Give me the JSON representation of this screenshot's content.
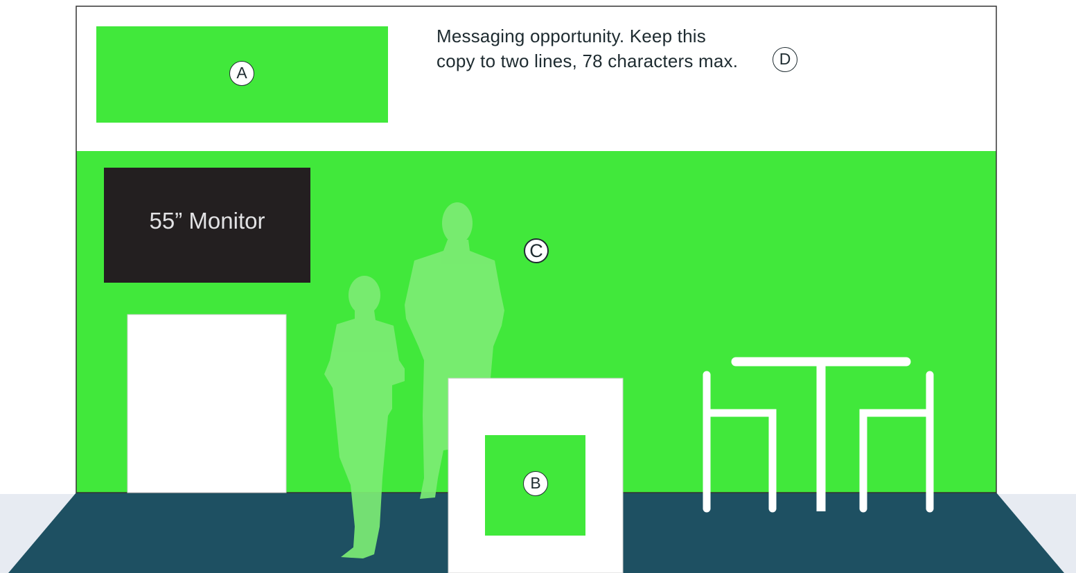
{
  "message": {
    "line1": "Messaging opportunity. Keep this",
    "line2": "copy to two lines, 78 characters max."
  },
  "monitor": {
    "label": "55” Monitor"
  },
  "markers": {
    "a": "A",
    "b": "B",
    "c": "C",
    "d": "D"
  },
  "colors": {
    "graphic_green": "#41e83b",
    "monitor_black": "#231f20",
    "floor_teal": "#1e5062",
    "side_floor": "#e7ebf2",
    "silhouette_green": "#7cec74",
    "furniture_white": "#ffffff",
    "text_dark": "#1e2b30"
  }
}
